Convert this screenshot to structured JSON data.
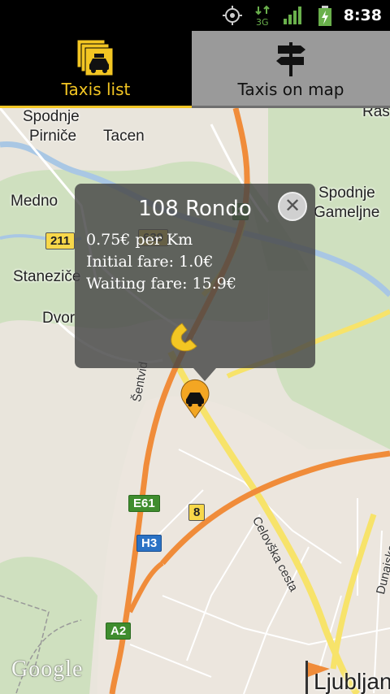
{
  "status_bar": {
    "time": "8:38",
    "network": "3G"
  },
  "tabs": [
    {
      "label": "Taxis list",
      "icon": "taxi-list-icon",
      "selected": true
    },
    {
      "label": "Taxis on map",
      "icon": "signpost-icon",
      "selected": false
    }
  ],
  "map": {
    "places": [
      "Spodnje",
      "Pirniče",
      "Tacen",
      "Medno",
      "Spodnje",
      "Gameljne",
      "Staneziče",
      "Dvor",
      "Ljubljan",
      "Ras"
    ],
    "roads": [
      "Šentvid",
      "Celovška cesta",
      "Dunajska cesta"
    ],
    "shields": [
      "211",
      "639",
      "2",
      "E61",
      "8",
      "H3",
      "A2"
    ],
    "watermark": "Google"
  },
  "popup": {
    "title": "108 Rondo",
    "price_per_km": "0.75€ per Km",
    "initial_fare": "Initial fare: 1.0€",
    "waiting_fare": "Waiting fare: 15.9€"
  },
  "colors": {
    "accent": "#f3c623",
    "tab_inactive": "#9a9a9a",
    "popup_bg": "#464646"
  }
}
